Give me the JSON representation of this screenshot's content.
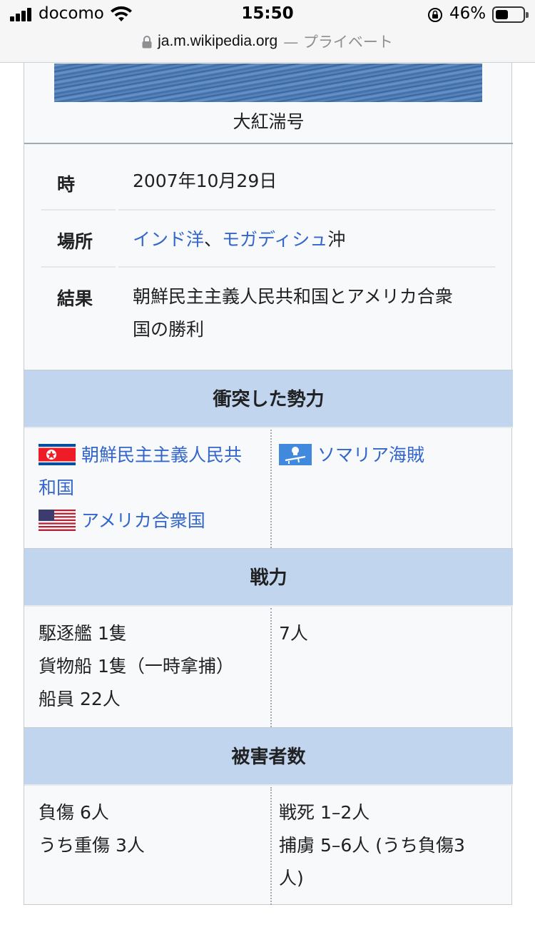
{
  "status_bar": {
    "carrier": "docomo",
    "time": "15:50",
    "battery_percent": "46%",
    "battery_level": 0.46
  },
  "url_bar": {
    "domain": "ja.m.wikipedia.org",
    "mode": "— プライベート"
  },
  "infobox": {
    "caption": "大紅湍号",
    "rows": [
      {
        "label": "時",
        "value": "2007年10月29日"
      },
      {
        "label": "場所",
        "link1": "インド洋",
        "sep": "、",
        "link2": "モガディシュ",
        "suffix": "沖"
      },
      {
        "label": "結果",
        "line1": "朝鮮民主主義人民共和国とアメリカ合衆",
        "line2": "国の勝利"
      }
    ],
    "sections": {
      "belligerents": {
        "title": "衝突した勢力",
        "left": [
          {
            "flag_icon": "north-korea-flag-icon",
            "line1": "朝鮮民主主義人民共",
            "line2": "和国"
          },
          {
            "flag_icon": "usa-flag-icon",
            "name": "アメリカ合衆国"
          }
        ],
        "right": {
          "flag_icon": "pirate-flag-icon",
          "name": "ソマリア海賊"
        }
      },
      "strength": {
        "title": "戦力",
        "left": [
          "駆逐艦 1隻",
          "貨物船 1隻（一時拿捕）",
          "船員 22人"
        ],
        "right": [
          "7人"
        ]
      },
      "casualties": {
        "title": "被害者数",
        "left": [
          "負傷 6人",
          "うち重傷 3人"
        ],
        "right": [
          "戦死 1–2人",
          "捕虜 5–6人 (うち負傷3",
          "人)"
        ]
      }
    }
  },
  "colors": {
    "link": "#3366cc",
    "section_header_bg": "#c2d5ee",
    "infobox_bg": "#f8f9fa",
    "border": "#c8ccd1"
  }
}
